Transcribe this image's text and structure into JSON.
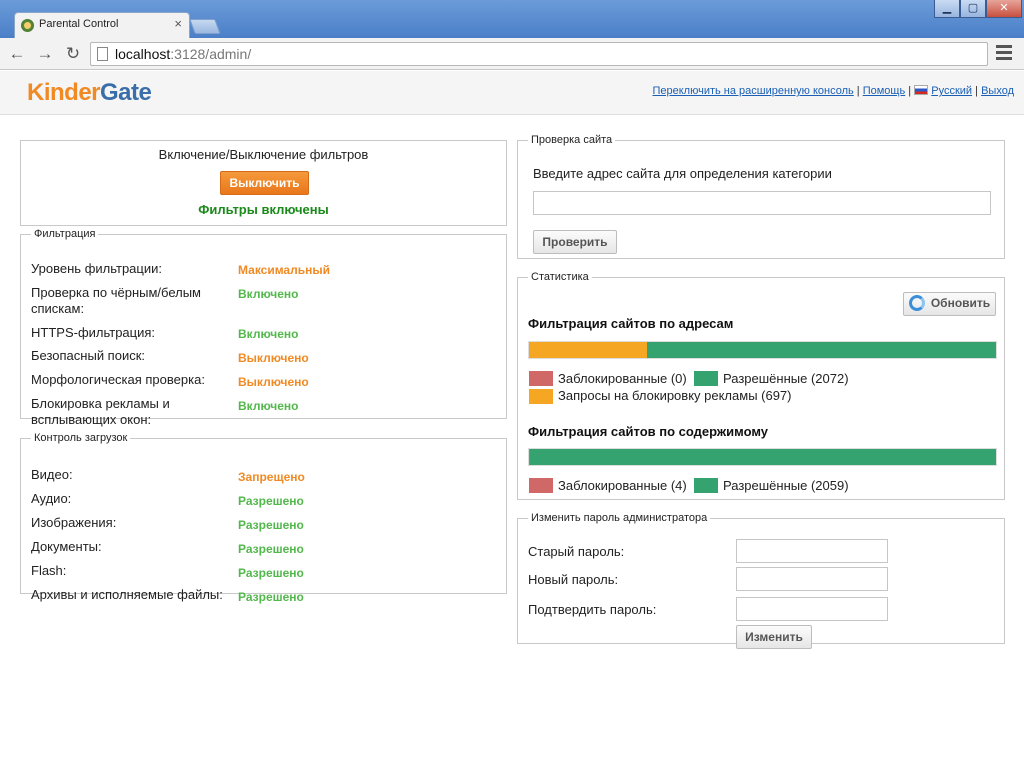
{
  "browser": {
    "tab_title": "Parental Control",
    "url_host": "localhost",
    "url_rest": ":3128/admin/"
  },
  "header": {
    "logo_part1": "Kinder",
    "logo_part2": "Gate",
    "links": {
      "advanced_console": "Переключить на расширенную консоль",
      "help": "Помощь",
      "language": "Русский",
      "logout": "Выход"
    }
  },
  "toggle_panel": {
    "title": "Включение/Выключение фильтров",
    "button_label": "Выключить",
    "status": "Фильтры включены"
  },
  "filtering": {
    "legend": "Фильтрация",
    "rows": [
      {
        "label": "Уровень фильтрации:",
        "value": "Максимальный",
        "color": "#f08a24"
      },
      {
        "label": "Проверка по чёрным/белым спискам:",
        "value": "Включено",
        "color": "#53b84b"
      },
      {
        "label": "HTTPS-фильтрация:",
        "value": "Включено",
        "color": "#53b84b"
      },
      {
        "label": "Безопасный поиск:",
        "value": "Выключено",
        "color": "#f08a24"
      },
      {
        "label": "Морфологическая проверка:",
        "value": "Выключено",
        "color": "#f08a24"
      },
      {
        "label": "Блокировка рекламы и всплывающих окон:",
        "value": "Включено",
        "color": "#53b84b"
      }
    ]
  },
  "downloads": {
    "legend": "Контроль загрузок",
    "rows": [
      {
        "label": "Видео:",
        "value": "Запрещено",
        "color": "#f08a24"
      },
      {
        "label": "Аудио:",
        "value": "Разрешено",
        "color": "#53b84b"
      },
      {
        "label": "Изображения:",
        "value": "Разрешено",
        "color": "#53b84b"
      },
      {
        "label": "Документы:",
        "value": "Разрешено",
        "color": "#53b84b"
      },
      {
        "label": "Flash:",
        "value": "Разрешено",
        "color": "#53b84b"
      },
      {
        "label": "Архивы и исполняемые файлы:",
        "value": "Разрешено",
        "color": "#53b84b"
      }
    ]
  },
  "site_check": {
    "legend": "Проверка сайта",
    "prompt": "Введите адрес сайта для определения категории",
    "input_value": "",
    "button_label": "Проверить"
  },
  "stats": {
    "legend": "Статистика",
    "refresh_label": "Обновить",
    "by_address": {
      "title": "Фильтрация сайтов по адресам",
      "blocked_label": "Заблокированные (0)",
      "allowed_label": "Разрешённые (2072)",
      "ads_label": "Запросы на блокировку рекламы (697)",
      "blocked": 0,
      "allowed": 2072,
      "ads": 697
    },
    "by_content": {
      "title": "Фильтрация сайтов по содержимому",
      "blocked_label": "Заблокированные (4)",
      "allowed_label": "Разрешённые (2059)",
      "blocked": 4,
      "allowed": 2059
    },
    "colors": {
      "blocked": "#d06868",
      "allowed": "#35a370",
      "ads": "#f5a623"
    }
  },
  "password": {
    "legend": "Изменить пароль администратора",
    "old_label": "Старый пароль:",
    "new_label": "Новый пароль:",
    "confirm_label": "Подтвердить пароль:",
    "button_label": "Изменить"
  }
}
